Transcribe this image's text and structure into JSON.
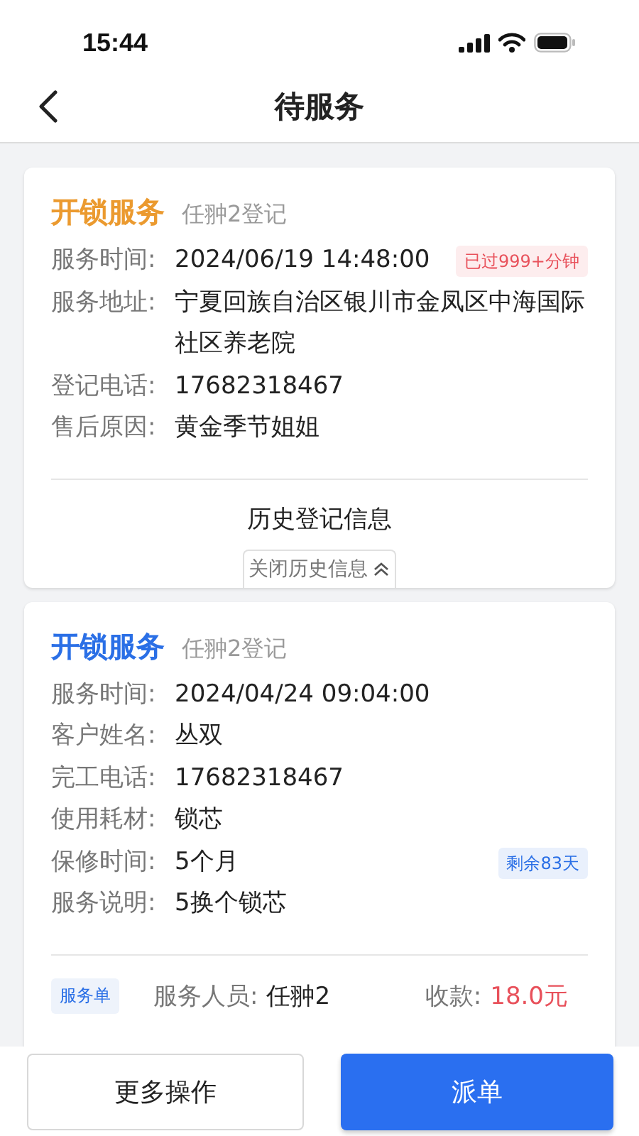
{
  "status_bar": {
    "time": "15:44"
  },
  "nav": {
    "title": "待服务"
  },
  "cards": [
    {
      "title": "开锁服务",
      "color": "#eb9a2f",
      "registrar": "任翀2登记",
      "fields": [
        {
          "label": "服务时间:",
          "value": "2024/06/19 14:48:00",
          "tag": {
            "text": "已过999+分钟",
            "color": "#e8515b"
          }
        },
        {
          "label": "服务地址:",
          "value": "宁夏回族自治区银川市金凤区中海国际社区养老院"
        },
        {
          "label": "登记电话:",
          "value": "17682318467"
        },
        {
          "label": "售后原因:",
          "value": "黄金季节姐姐"
        }
      ],
      "history": {
        "title": "历史登记信息",
        "toggle": "关闭历史信息"
      }
    },
    {
      "title": "开锁服务",
      "color": "#2a6fe6",
      "registrar": "任翀2登记",
      "fields": [
        {
          "label": "服务时间:",
          "value": "2024/04/24 09:04:00"
        },
        {
          "label": "客户姓名:",
          "value": "丛双"
        },
        {
          "label": "完工电话:",
          "value": "17682318467"
        },
        {
          "label": "使用耗材:",
          "value": "锁芯"
        },
        {
          "label": "保修时间:",
          "value": "5个月",
          "tag": {
            "text": "剩余83天",
            "color": "#2a6fe6"
          }
        },
        {
          "label": "服务说明:",
          "value": "5换个锁芯"
        }
      ],
      "summary": {
        "badge": "服务单",
        "staff_label": "服务人员:",
        "staff": "任翀2",
        "amount_label": "收款:",
        "amount": "18.0元"
      }
    }
  ],
  "buttons": [
    {
      "label": "更多操作",
      "kind": "secondary"
    },
    {
      "label": "派单",
      "kind": "primary"
    }
  ]
}
